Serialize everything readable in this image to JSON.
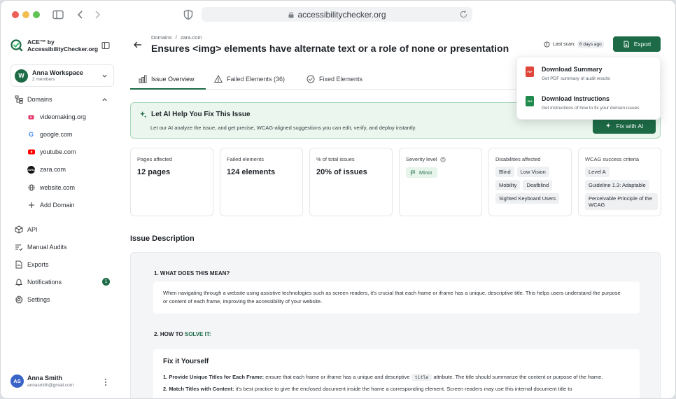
{
  "browser": {
    "url": "accessibilitychecker.org"
  },
  "logo": {
    "line1": "ACE™ by",
    "line2": "AccessibilityChecker.org"
  },
  "workspace": {
    "initial": "W",
    "name": "Anna Workspace",
    "members": "2 members"
  },
  "sidebar": {
    "domains_label": "Domains",
    "domains": [
      {
        "label": "videomaking.org",
        "icon": "videomaking-favicon",
        "color": "#e8386b"
      },
      {
        "label": "google.com",
        "icon": "google-favicon",
        "color": "#4285f4"
      },
      {
        "label": "youtube.com",
        "icon": "youtube-favicon",
        "color": "#ff0000"
      },
      {
        "label": "zara.com",
        "icon": "zara-favicon",
        "color": "#111111"
      },
      {
        "label": "website.com",
        "icon": "globe-icon",
        "color": "#555555"
      }
    ],
    "add_domain": "Add Domain",
    "items": [
      {
        "label": "API",
        "icon": "cube-icon"
      },
      {
        "label": "Manual Audits",
        "icon": "checklist-icon"
      },
      {
        "label": "Exports",
        "icon": "file-export-icon"
      },
      {
        "label": "Notifications",
        "icon": "bell-icon",
        "badge": "1"
      },
      {
        "label": "Settings",
        "icon": "gear-icon"
      }
    ]
  },
  "user": {
    "initials": "AS",
    "name": "Anna Smith",
    "email": "annasmith@gmail.com"
  },
  "header": {
    "breadcrumb_root": "Domains",
    "breadcrumb_sep": "/",
    "breadcrumb_leaf": "zara.com",
    "title": "Ensures <img> elements have alternate text or a role of none or presentation",
    "last_scan_label": "Last scan:",
    "last_scan_value": "6 days ago",
    "export_label": "Export"
  },
  "export_menu": [
    {
      "title": "Download Summary",
      "subtitle": "Get PDF summary of audit results",
      "file": "PDF",
      "color": "#e0453a"
    },
    {
      "title": "Download Instructions",
      "subtitle": "Get instructions of how to fix your domain issues",
      "file": "XLS",
      "color": "#1f8a4c"
    }
  ],
  "tabs": [
    {
      "label": "Issue Overview",
      "icon": "bar-chart-icon"
    },
    {
      "label": "Failed Elements (36)",
      "icon": "warning-icon"
    },
    {
      "label": "Fixed Elements",
      "icon": "check-circle-icon"
    }
  ],
  "ai_banner": {
    "title": "Let AI Help You Fix This Issue",
    "description": "Let our AI analyze the issue, and get precise, WCAG-aligned suggestions you can edit, verify, and deploy instantly.",
    "button": "Fix with AI"
  },
  "stats": {
    "pages_label": "Pages affected",
    "pages_value": "12 pages",
    "failed_label": "Failed elements",
    "failed_value": "124 elements",
    "percent_label": "% of total issues",
    "percent_value": "20% of issues",
    "severity_label": "Severity level",
    "severity_value": "Minor",
    "disabilities_label": "Disabilities affected",
    "disabilities": [
      "Blind",
      "Low Vision",
      "Mobility",
      "Deafblind",
      "Sighted Keyboard Users"
    ],
    "wcag_label": "WCAG success criteria",
    "wcag": [
      "Level A",
      "Guideline 1.3: Adaptable",
      "Perceivable Principle of the WCAG"
    ]
  },
  "description": {
    "section_title": "Issue Description",
    "q1": "1.  WHAT DOES THIS MEAN?",
    "q1_text": "When navigating through a website using assistive technologies such as screen readers, it's crucial that each frame or iframe has a unique, descriptive title. This helps users understand the purpose or content of each frame, improving the accessibility of your website.",
    "q2_prefix": "2.  HOW TO ",
    "q2_highlight": "SOLVE IT:",
    "fix_title": "Fix it Yourself",
    "fix1_num": "1.",
    "fix1_bold": "Provide Unique Titles for Each Frame:",
    "fix1_text_a": "ensure that each frame or iframe has a unique and descriptive",
    "fix1_code": "title",
    "fix1_text_b": "attribute. The title should summarize the content or purpose of the frame.",
    "fix2_num": "2.",
    "fix2_bold": "Match Titles with Content:",
    "fix2_text": "it's best practice to give the enclosed document inside the frame a corresponding element. Screen readers may use this internal document title to"
  },
  "colors": {
    "brand_green": "#1d6b46",
    "banner_bg": "#eaf6ee"
  }
}
